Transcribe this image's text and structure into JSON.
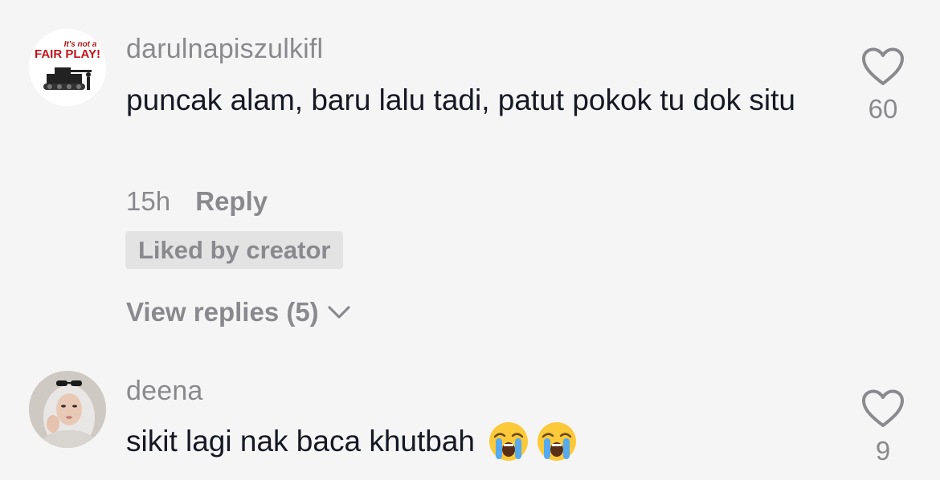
{
  "comments": [
    {
      "username": "darulnapiszulkifl",
      "avatar_text": "It's not a FAIR PLAY!",
      "text": "puncak alam, baru lalu tadi, patut pokok tu dok situ",
      "time": "15h",
      "reply_label": "Reply",
      "badge": "Liked by creator",
      "view_replies": "View replies (5)",
      "likes": "60"
    },
    {
      "username": "deena",
      "text": "sikit lagi nak baca khutbah",
      "emojis": [
        "loudly-crying-face",
        "loudly-crying-face"
      ],
      "likes": "9"
    }
  ],
  "colors": {
    "background": "#f5f5f5",
    "primary_text": "#161823",
    "secondary_text": "#8a8a8e",
    "badge_bg": "#e3e3e3"
  },
  "icons": [
    "heart-outline-icon",
    "chevron-down-icon",
    "loudly-crying-face-emoji"
  ]
}
